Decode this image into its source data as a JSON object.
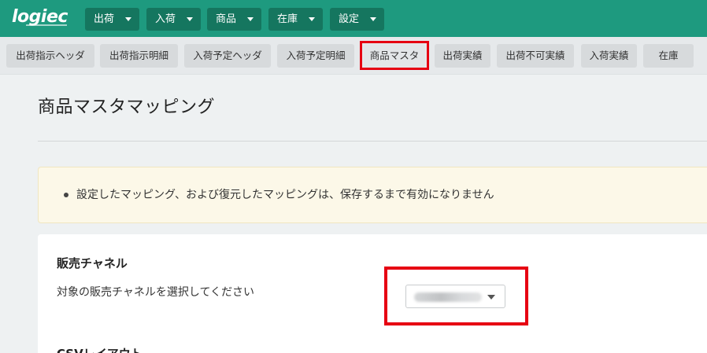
{
  "app": {
    "logo_text": "logiec",
    "menus": [
      "出荷",
      "入荷",
      "商品",
      "在庫",
      "設定"
    ]
  },
  "subnav": {
    "items": [
      "出荷指示ヘッダ",
      "出荷指示明細",
      "入荷予定ヘッダ",
      "入荷予定明細",
      "商品マスタ",
      "出荷実績",
      "出荷不可実績",
      "入荷実績",
      "在庫"
    ],
    "active": "商品マスタ"
  },
  "page": {
    "title": "商品マスタマッピング",
    "notice": "設定したマッピング、および復元したマッピングは、保存するまで有効になりません"
  },
  "channel": {
    "heading": "販売チャネル",
    "description": "対象の販売チャネルを選択してください",
    "select_value": ""
  },
  "csv": {
    "heading": "CSVレイアウト"
  },
  "colors": {
    "primary": "#1e9a7f",
    "menu_button": "#15765f",
    "highlight": "#e60012",
    "notice_bg": "#fcf8e8"
  }
}
